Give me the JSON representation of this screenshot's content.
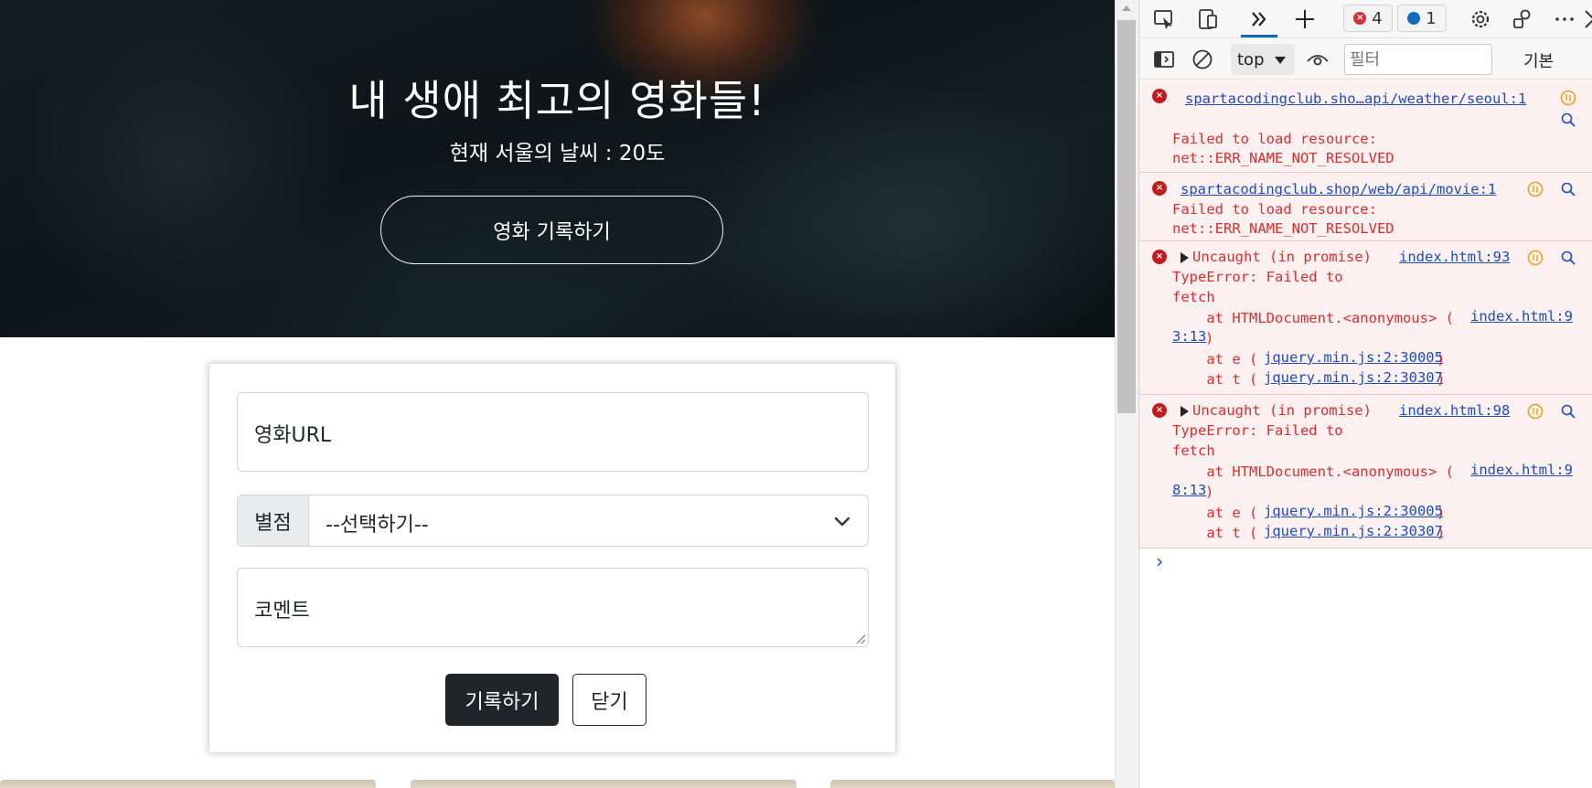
{
  "hero": {
    "title": "내 생애 최고의 영화들!",
    "weather": "현재 서울의 날씨 : 20도",
    "record_button": "영화 기록하기"
  },
  "form": {
    "url_placeholder": "영화URL",
    "star_label": "별점",
    "star_selected": "--선택하기--",
    "comment_placeholder": "코멘트",
    "save_button": "기록하기",
    "close_button": "닫기"
  },
  "devtools": {
    "error_count": "4",
    "message_count": "1",
    "context": "top",
    "filter_placeholder": "필터",
    "levels": "기본",
    "entries": [
      {
        "link": "spartacodingclub.sho…api/weather/seoul:1",
        "lines": [
          "Failed to load resource:",
          "net::ERR_NAME_NOT_RESOLVED"
        ]
      },
      {
        "link": "spartacodingclub.shop/web/api/movie:1",
        "lines": [
          "Failed to load resource:",
          "net::ERR_NAME_NOT_RESOLVED"
        ]
      },
      {
        "head": "Uncaught (in promise)",
        "link": "index.html:93",
        "lines": [
          "TypeError: Failed to",
          "fetch"
        ],
        "stack_prefix": "    at HTMLDocument.<anonymous> (",
        "stack_link_a": "index.html:9",
        "stack_link_b": "3:13",
        "frames": [
          {
            "prefix": "    at e (",
            "link": "jquery.min.js:2:30005"
          },
          {
            "prefix": "    at t (",
            "link": "jquery.min.js:2:30307"
          }
        ]
      },
      {
        "head": "Uncaught (in promise)",
        "link": "index.html:98",
        "lines": [
          "TypeError: Failed to",
          "fetch"
        ],
        "stack_prefix": "    at HTMLDocument.<anonymous> (",
        "stack_link_a": "index.html:9",
        "stack_link_b": "8:13",
        "frames": [
          {
            "prefix": "    at e (",
            "link": "jquery.min.js:2:30005"
          },
          {
            "prefix": "    at t (",
            "link": "jquery.min.js:2:30307"
          }
        ]
      }
    ],
    "close_paren": ")",
    "prompt": "›"
  },
  "colors": {
    "accent": "#0f6cbd",
    "error": "#e22a2a",
    "error_bg": "#fdf0f0",
    "button_dark": "#212529"
  }
}
